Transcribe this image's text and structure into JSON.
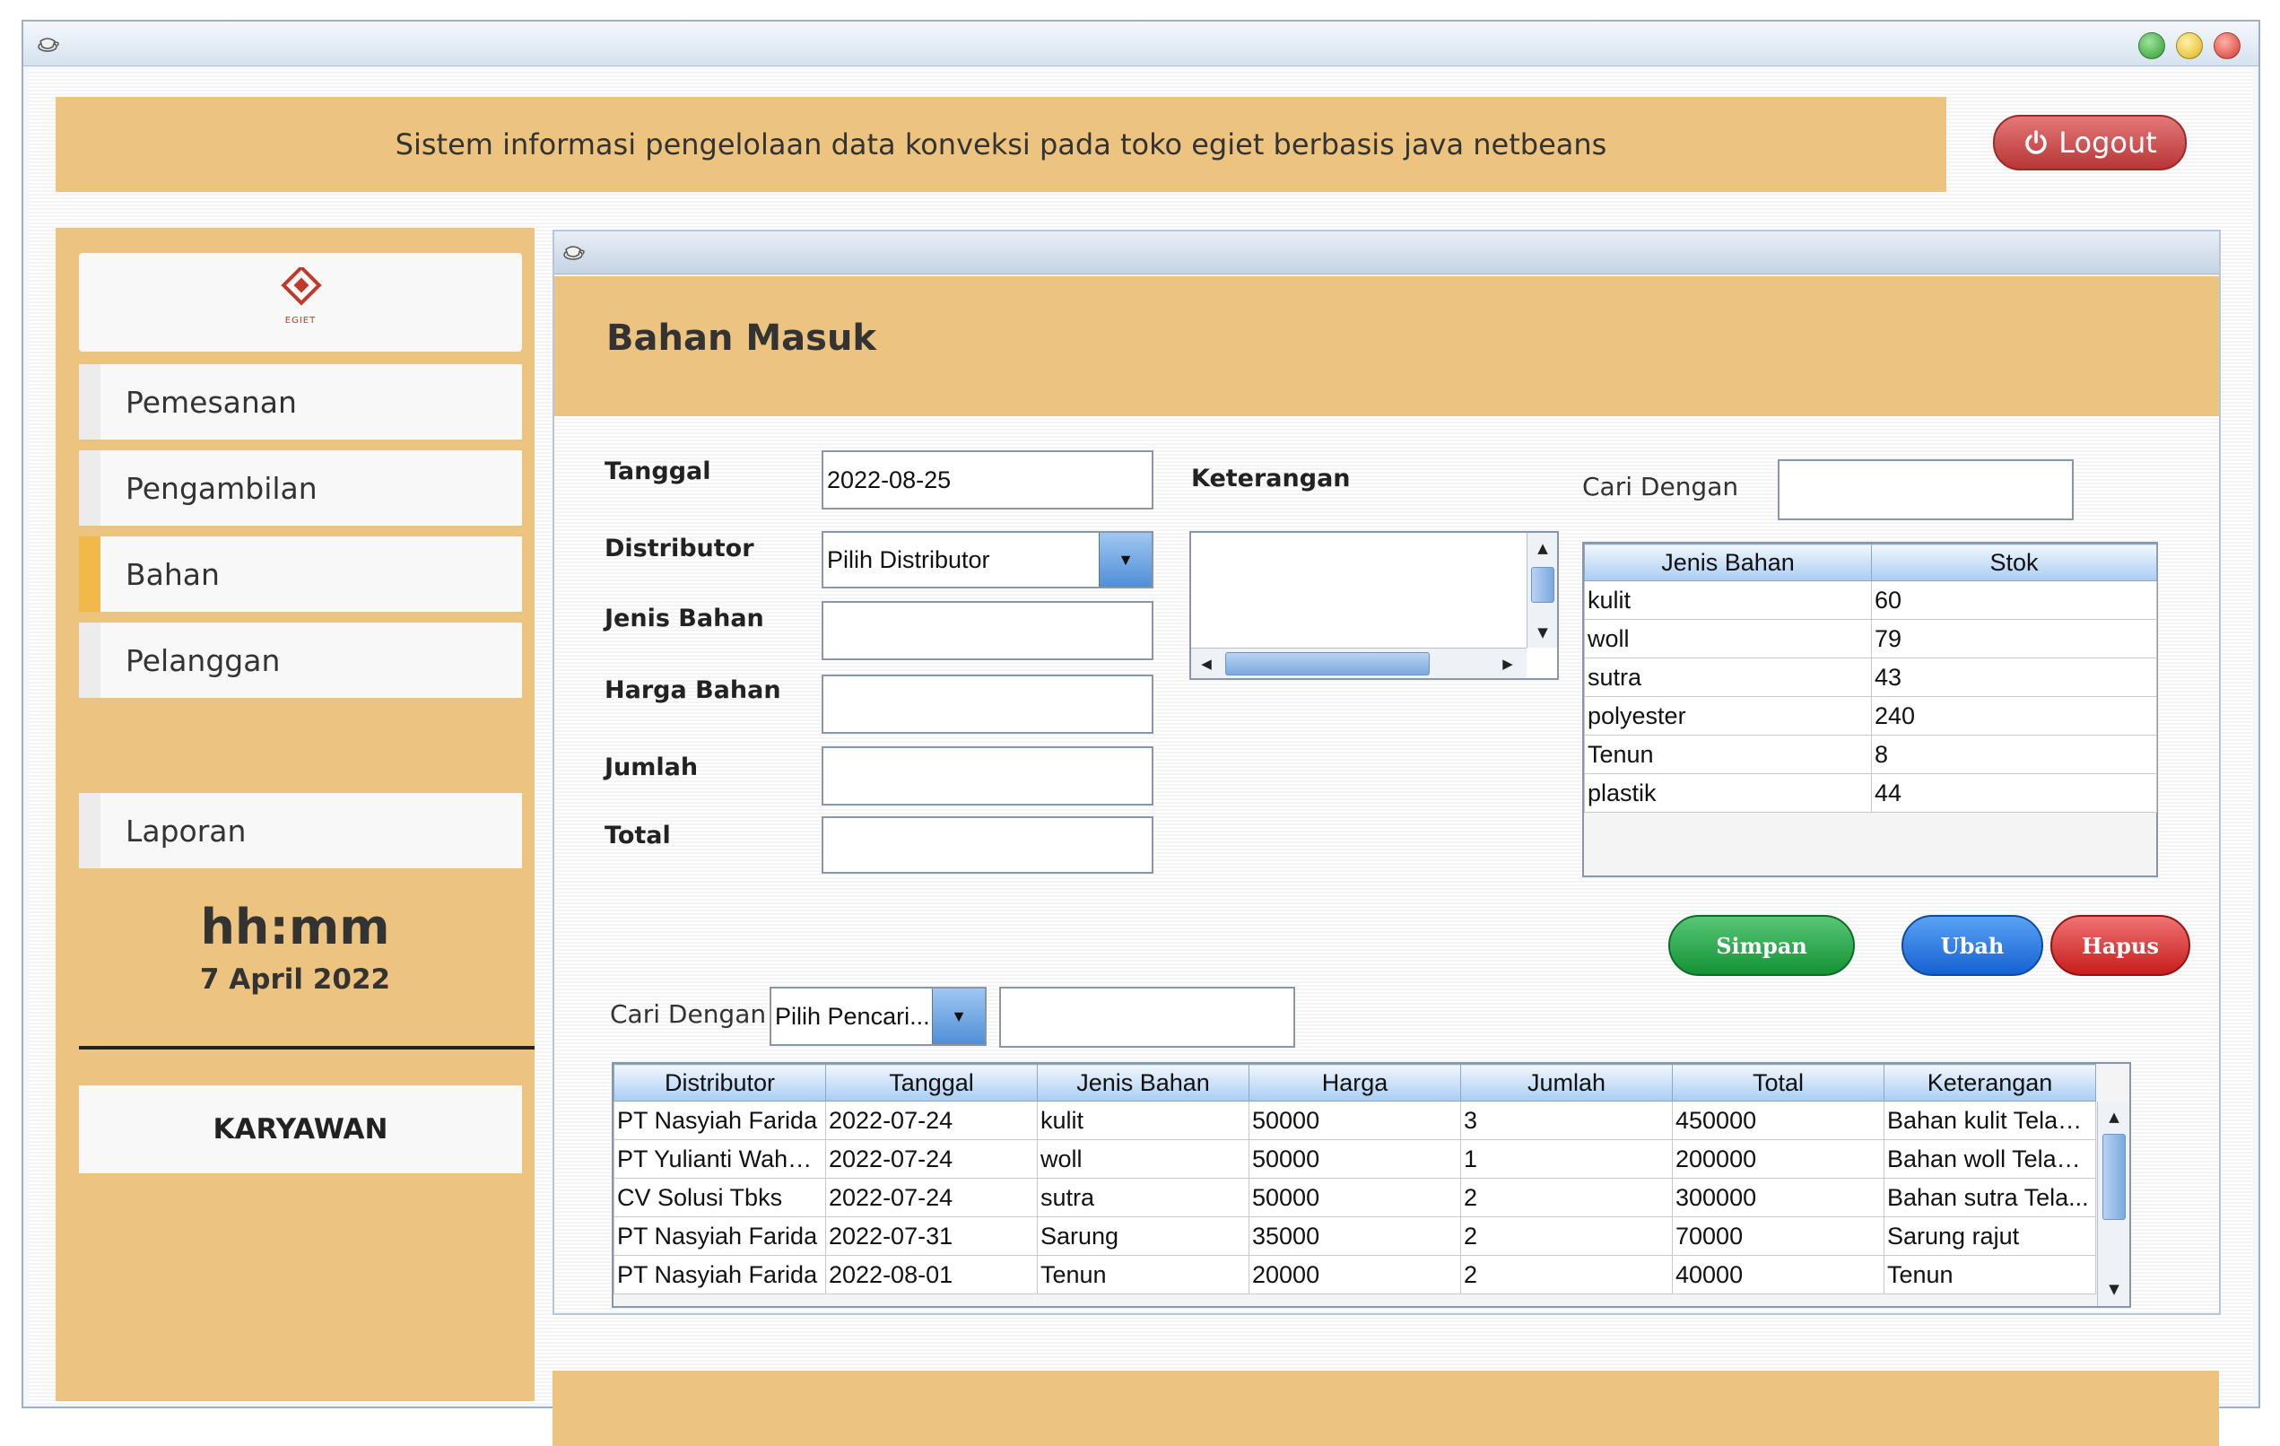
{
  "header": {
    "title": "Sistem informasi pengelolaan data konveksi pada toko egiet berbasis java netbeans",
    "logout_label": "Logout"
  },
  "sidebar": {
    "logo_text": "EGIET",
    "items": [
      {
        "label": "Pemesanan"
      },
      {
        "label": "Pengambilan"
      },
      {
        "label": "Bahan"
      },
      {
        "label": "Pelanggan"
      }
    ],
    "laporan_label": "Laporan",
    "clock": "hh:mm",
    "date": "7 April 2022",
    "role": "KARYAWAN"
  },
  "form": {
    "page_title": "Bahan Masuk",
    "tanggal_label": "Tanggal",
    "tanggal_value": "2022-08-25",
    "distributor_label": "Distributor",
    "distributor_selected": "Pilih Distributor",
    "jenis_label": "Jenis Bahan",
    "harga_label": "Harga Bahan",
    "jumlah_label": "Jumlah",
    "total_label": "Total",
    "keterangan_label": "Keterangan",
    "cari_label": "Cari Dengan",
    "cari_bawah_label": "Cari Dengan",
    "pencarian_selected": "Pilih Pencari..."
  },
  "buttons": {
    "simpan": "Simpan",
    "ubah": "Ubah",
    "hapus": "Hapus"
  },
  "stok_table": {
    "headers": [
      "Jenis Bahan",
      "Stok"
    ],
    "rows": [
      [
        "kulit",
        "60"
      ],
      [
        "woll",
        "79"
      ],
      [
        "sutra",
        "43"
      ],
      [
        "polyester",
        "240"
      ],
      [
        "Tenun",
        "8"
      ],
      [
        "plastik",
        "44"
      ]
    ]
  },
  "main_table": {
    "headers": [
      "Distributor",
      "Tanggal",
      "Jenis Bahan",
      "Harga",
      "Jumlah",
      "Total",
      "Keterangan"
    ],
    "rows": [
      [
        "PT Nasyiah Farida",
        "2022-07-24",
        "kulit",
        "50000",
        "3",
        "450000",
        "Bahan kulit Telah ..."
      ],
      [
        "PT Yulianti Wahyu...",
        "2022-07-24",
        "woll",
        "50000",
        "1",
        "200000",
        "Bahan woll Telah ..."
      ],
      [
        "CV Solusi Tbks",
        "2022-07-24",
        "sutra",
        "50000",
        "2",
        "300000",
        "Bahan sutra Tela..."
      ],
      [
        "PT Nasyiah Farida",
        "2022-07-31",
        "Sarung",
        "35000",
        "2",
        "70000",
        "Sarung rajut"
      ],
      [
        "PT Nasyiah Farida",
        "2022-08-01",
        "Tenun",
        "20000",
        "2",
        "40000",
        "Tenun"
      ]
    ]
  },
  "colors": {
    "panel": "#ecc47f",
    "logout": "#b73636",
    "simpan": "#149235",
    "ubah": "#1561d2",
    "hapus": "#c71d1d"
  }
}
